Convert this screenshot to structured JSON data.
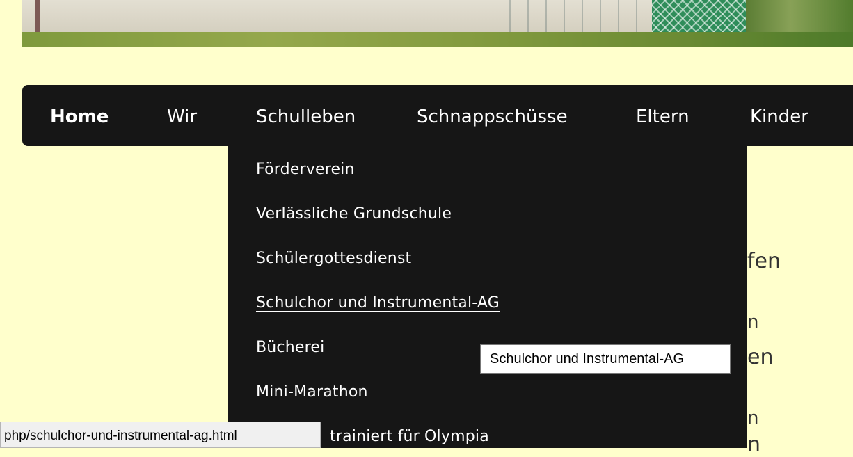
{
  "nav": {
    "items": [
      {
        "label": "Home"
      },
      {
        "label": "Wir"
      },
      {
        "label": "Schulleben"
      },
      {
        "label": "Schnappschüsse"
      },
      {
        "label": "Eltern"
      },
      {
        "label": "Kinder"
      }
    ],
    "active": "Home"
  },
  "dropdown": {
    "parent": "Schulleben",
    "items": [
      {
        "label": "Förderverein"
      },
      {
        "label": "Verlässliche Grundschule"
      },
      {
        "label": "Schülergottesdienst"
      },
      {
        "label": "Schulchor und Instrumental-AG"
      },
      {
        "label": "Bücherei"
      },
      {
        "label": "Mini-Marathon"
      },
      {
        "label": "trainiert für Olympia"
      }
    ],
    "hovered": "Schulchor und Instrumental-AG"
  },
  "background_text": {
    "fragment1": "fen",
    "fragment2": "n",
    "fragment3": "en",
    "fragment4": "n",
    "fragment5": "n"
  },
  "tooltip": {
    "text": "Schulchor und Instrumental-AG"
  },
  "statusbar": {
    "url": "php/schulchor-und-instrumental-ag.html"
  },
  "colors": {
    "nav_bg": "#161616",
    "page_bg": "#ffffcc",
    "text": "#ffffff"
  }
}
